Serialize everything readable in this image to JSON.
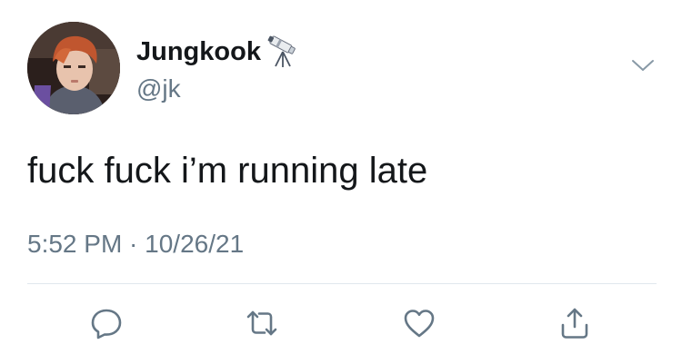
{
  "tweet": {
    "author": {
      "display_name": "Jungkook",
      "name_emoji": "telescope-emoji",
      "handle": "@jk"
    },
    "text": "fuck fuck i’m running late",
    "timestamp": "5:52 PM · 10/26/21"
  },
  "actions": [
    {
      "name": "reply",
      "icon": "speech-bubble-icon"
    },
    {
      "name": "retweet",
      "icon": "retweet-arrows-icon"
    },
    {
      "name": "like",
      "icon": "heart-icon"
    },
    {
      "name": "share",
      "icon": "share-icon"
    }
  ],
  "colors": {
    "text_primary": "#14171a",
    "text_secondary": "#657786",
    "icon": "#657786",
    "divider": "#e1e8ed"
  }
}
